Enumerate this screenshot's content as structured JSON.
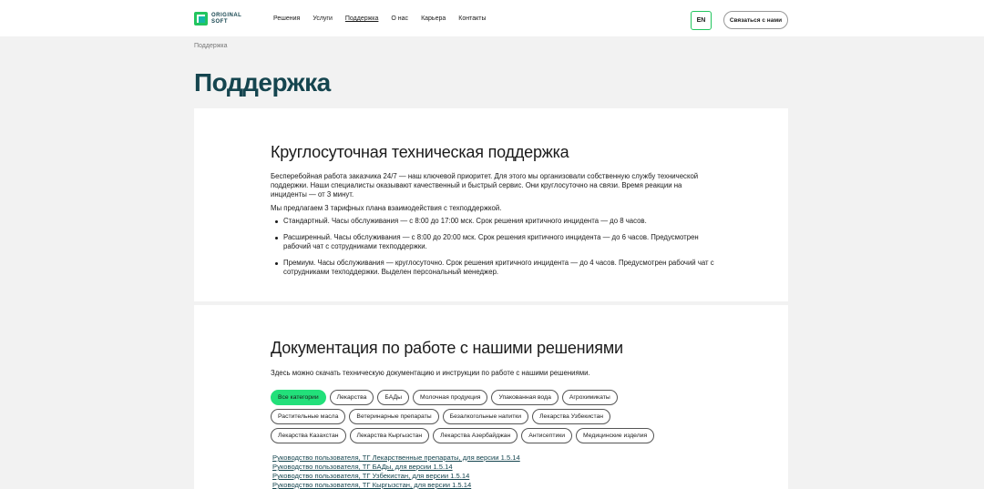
{
  "header": {
    "logo_line1": "ORIGINAL",
    "logo_line2": "SOFT",
    "nav": [
      "Решения",
      "Услуги",
      "Поддержка",
      "О нас",
      "Карьера",
      "Контакты"
    ],
    "lang": "EN",
    "contact_label": "Связаться с нами"
  },
  "breadcrumb": "Поддержка",
  "page_title": "Поддержка",
  "support": {
    "title": "Круглосуточная техническая поддержка",
    "intro": "Бесперебойная работа заказчика 24/7 — наш ключевой приоритет. Для этого мы организовали собственную службу технической поддержки. Наши специалисты оказывают качественный и быстрый сервис. Они круглосуточно на связи. Время реакции на инциденты — от 3 минут.",
    "plans_intro": "Мы предлагаем 3 тарифных плана взаимодействия с техподдержкой.",
    "plans": [
      "Стандартный. Часы обслуживания — с 8:00 до 17:00 мск. Срок решения критичного инцидента — до 8 часов.",
      "Расширенный. Часы обслуживания — с 8:00 до 20:00 мск. Срок решения критичного инцидента — до 6 часов. Предусмотрен рабочий чат с сотрудниками техподдержки.",
      "Премиум. Часы обслуживания — круглосуточно. Срок решения критичного инцидента — до 4 часов. Предусмотрен рабочий чат с сотрудниками техподдержки. Выделен персональный менеджер."
    ]
  },
  "docs": {
    "title": "Документация по работе с нашими решениями",
    "intro": "Здесь можно скачать техническую документацию и инструкции по работе с нашими решениями.",
    "categories": [
      "Все категории",
      "Лекарства",
      "БАДы",
      "Молочная продукция",
      "Упакованная вода",
      "Агрохимикаты",
      "Растительные масла",
      "Ветеринарные препараты",
      "Безалкогольные напитки",
      "Лекарства Узбекистан",
      "Лекарства Казахстан",
      "Лекарства Кыргызстан",
      "Лекарства Азербайджан",
      "Антисептики",
      "Медицинские изделия"
    ],
    "links": [
      "Руководство пользователя, ТГ Лекарственные препараты, для версии 1.5.14",
      "Руководство пользователя, ТГ БАДы, для версии 1.5.14",
      "Руководство пользователя, ТГ Узбекистан, для версии 1.5.14",
      "Руководство пользователя, ТГ Кыргызстан, для версии 1.5.14"
    ]
  },
  "colors": {
    "accent": "#22e07a",
    "brand": "#15454f"
  }
}
